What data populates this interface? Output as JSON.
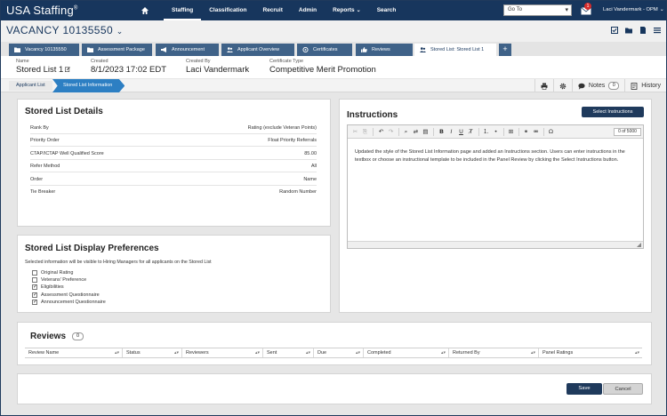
{
  "app": {
    "logo": "USA Staffing",
    "logo_mark": "®",
    "nav": [
      "Staffing",
      "Classification",
      "Recruit",
      "Admin",
      "Reports",
      "Search"
    ],
    "nav_caret_item": "Reports",
    "goto_label": "Go To",
    "mail_badge": "1",
    "user_name": "Laci Vandermark - OPM"
  },
  "vacancy": {
    "title": "VACANCY 10135550"
  },
  "tabs": [
    {
      "label": "Vacancy 10135550",
      "icon": "folder-icon"
    },
    {
      "label": "Assessment Package",
      "icon": "folder-icon"
    },
    {
      "label": "Announcement",
      "icon": "megaphone-icon"
    },
    {
      "label": "Applicant Overview",
      "icon": "users-icon"
    },
    {
      "label": "Certificates",
      "icon": "certificate-icon"
    },
    {
      "label": "Reviews",
      "icon": "thumbs-up-icon"
    },
    {
      "label": "Stored List: Stored List 1",
      "icon": "users-icon"
    }
  ],
  "info": {
    "name_label": "Name",
    "name_value": "Stored List 1",
    "created_label": "Created",
    "created_value": "8/1/2023 17:02 EDT",
    "created_by_label": "Created By",
    "created_by_value": "Laci Vandermark",
    "cert_type_label": "Certificate Type",
    "cert_type_value": "Competitive Merit Promotion"
  },
  "breadcrumb": {
    "item1": "Applicant List",
    "item2": "Stored List Information"
  },
  "toolbar": {
    "notes_label": "Notes",
    "notes_count": "0",
    "history_label": "History"
  },
  "details": {
    "title": "Stored List Details",
    "rows": [
      {
        "key": "Rank By",
        "value": "Rating (exclude Veteran Points)"
      },
      {
        "key": "Priority Order",
        "value": "Float Priority Referrals"
      },
      {
        "key": "CTAP/ICTAP Well Qualified Score",
        "value": "85.00"
      },
      {
        "key": "Refer Method",
        "value": "All"
      },
      {
        "key": "Order",
        "value": "Name"
      },
      {
        "key": "Tie Breaker",
        "value": "Random Number"
      }
    ]
  },
  "preferences": {
    "title": "Stored List Display Preferences",
    "description": "Selected information will be visible to Hiring Managers for all applicants on the Stored List",
    "options": [
      {
        "label": "Original Rating",
        "checked": false
      },
      {
        "label": "Veterans' Preference",
        "checked": false
      },
      {
        "label": "Eligibilities",
        "checked": true
      },
      {
        "label": "Assessment Questionnaire",
        "checked": true
      },
      {
        "label": "Announcement Questionnaire",
        "checked": true
      }
    ]
  },
  "instructions": {
    "title": "Instructions",
    "select_button": "Select Instructions",
    "counter": "0 of 5000",
    "body": "Updated the style of the Stored List Information page and added an Instructions section. Users can enter instructions in the textbox or choose an instructional template to be included in the Panel Review by clicking the Select Instructions button."
  },
  "reviews": {
    "title": "Reviews",
    "count": "0",
    "columns": [
      "Review Name",
      "Status",
      "Reviewers",
      "Sent",
      "Due",
      "Completed",
      "Returned By",
      "Panel Ratings"
    ]
  },
  "actions": {
    "save": "Save",
    "cancel": "Cancel"
  },
  "colors": {
    "nav_bg": "#17365d",
    "tab_bg": "#3f6288",
    "breadcrumb_active": "#2d7fc3",
    "primary_button": "#1f3a5c"
  }
}
